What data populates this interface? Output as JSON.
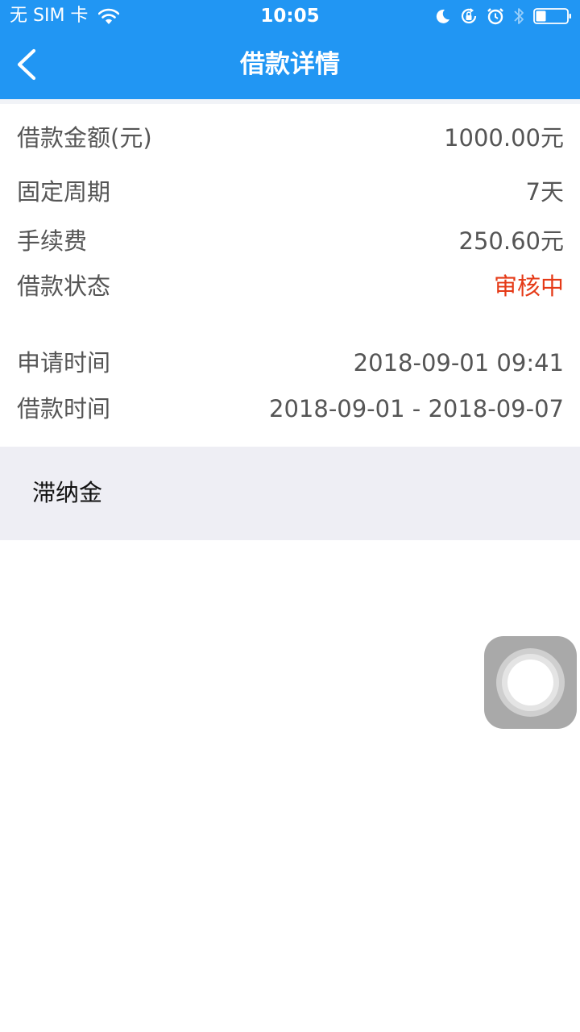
{
  "status_bar": {
    "carrier": "无 SIM 卡",
    "time": "10:05",
    "icons": [
      "wifi-icon",
      "moon-icon",
      "rotation-lock-icon",
      "alarm-icon",
      "bluetooth-icon",
      "battery-icon"
    ]
  },
  "nav": {
    "title": "借款详情",
    "back_icon": "chevron-left-icon"
  },
  "details": [
    {
      "label": "借款金额(元)",
      "value": "1000.00元"
    },
    {
      "label": "固定周期",
      "value": "7天"
    },
    {
      "label": "手续费",
      "value": "250.60元"
    },
    {
      "label": "借款状态",
      "value": "审核中"
    },
    {
      "label": "申请时间",
      "value": "2018-09-01 09:41"
    },
    {
      "label": "借款时间",
      "value": "2018-09-01 - 2018-09-07"
    }
  ],
  "late_fee": {
    "label": "滞纳金"
  },
  "colors": {
    "header_blue": "#2196f3",
    "status_red": "#e53a17",
    "text_gray": "#555555",
    "section_bg": "#eeeef4"
  }
}
